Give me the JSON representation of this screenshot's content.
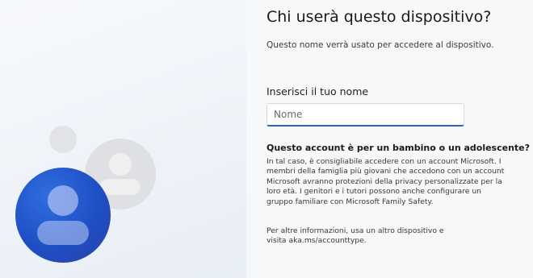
{
  "header": {
    "title": "Chi userà questo dispositivo?",
    "subtitle": "Questo nome verrà usato per accedere al dispositivo."
  },
  "name_field": {
    "label": "Inserisci il tuo nome",
    "placeholder": "Nome",
    "value": ""
  },
  "info": {
    "heading": "Questo account è per un bambino o un adolescente?",
    "paragraph1": "In tal caso, è consigliabile accedere con un account Microsoft. I membri della famiglia più giovani che accedono con un account Microsoft avranno protezioni della privacy personalizzate per la loro età. I genitori e i tutori possono anche configurare un gruppo familiare con Microsoft Family Safety.",
    "paragraph2": "Per altre informazioni, usa un altro dispositivo e visita aka.ms/accounttype."
  },
  "illustration": {
    "icons": [
      "user-avatar-icon",
      "user-avatar-icon",
      "dot-icon"
    ],
    "colors": {
      "accent_blue": "#1f4fc4",
      "gray_avatar": "#dfe0e3",
      "input_underline": "#2f62b8"
    }
  }
}
